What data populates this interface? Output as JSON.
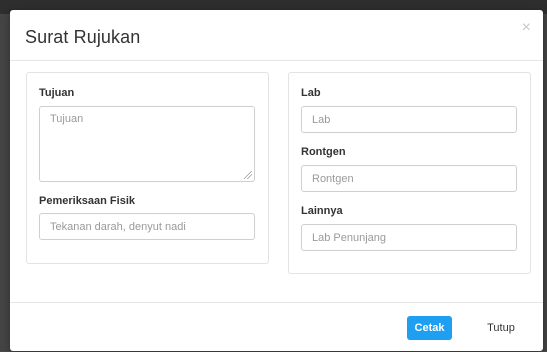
{
  "modal": {
    "title": "Surat Rujukan",
    "close_symbol": "×"
  },
  "left_panel": {
    "tujuan": {
      "label": "Tujuan",
      "placeholder": "Tujuan",
      "value": ""
    },
    "pemeriksaan_fisik": {
      "label": "Pemeriksaan Fisik",
      "placeholder": "Tekanan darah, denyut nadi",
      "value": ""
    }
  },
  "right_panel": {
    "lab": {
      "label": "Lab",
      "placeholder": "Lab",
      "value": ""
    },
    "rontgen": {
      "label": "Rontgen",
      "placeholder": "Rontgen",
      "value": ""
    },
    "lainnya": {
      "label": "Lainnya",
      "placeholder": "Lab Penunjang",
      "value": ""
    }
  },
  "footer": {
    "cetak_label": "Cetak",
    "tutup_label": "Tutup"
  },
  "colors": {
    "primary_button": "#1e9ff2",
    "backdrop": "#4a4a4a"
  },
  "icons": {
    "close": "close-icon",
    "resize": "resize-grip-icon"
  }
}
